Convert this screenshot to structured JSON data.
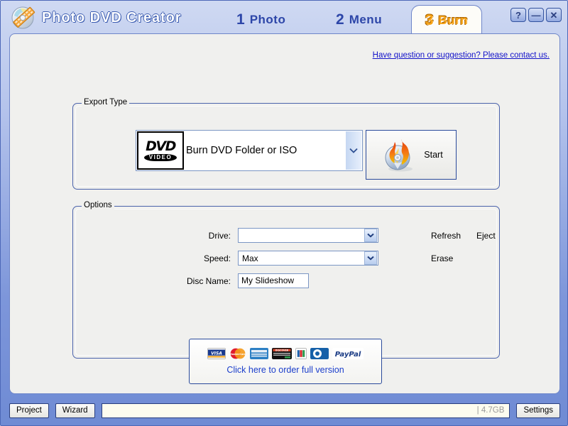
{
  "window": {
    "app_title": "Photo DVD Creator",
    "logo_icon": "disc-filmstrip-icon",
    "controls": [
      {
        "name": "help-button",
        "glyph": "?"
      },
      {
        "name": "minimize-button",
        "glyph": "—"
      },
      {
        "name": "close-button",
        "glyph": "✕"
      }
    ]
  },
  "tabs": [
    {
      "num": "1",
      "label": "Photo",
      "active": false
    },
    {
      "num": "2",
      "label": "Menu",
      "active": false
    },
    {
      "num": "3",
      "label": "Burn",
      "active": true
    }
  ],
  "contact_link": "Have question or suggestion? Please contact us.",
  "export_type": {
    "group_title": "Export Type",
    "combo_value": "Burn DVD Folder or ISO",
    "combo_icon": "dvd-video-logo",
    "dvd_logo_word": "DVD",
    "dvd_logo_sub": "VIDEO",
    "start_label": "Start",
    "start_icon": "burning-disc-icon"
  },
  "options": {
    "group_title": "Options",
    "drive": {
      "label": "Drive:",
      "value": ""
    },
    "speed": {
      "label": "Speed:",
      "value": "Max"
    },
    "disc_name": {
      "label": "Disc Name:",
      "value": "My Slideshow"
    },
    "actions": {
      "refresh": "Refresh",
      "eject": "Eject",
      "erase": "Erase"
    }
  },
  "order": {
    "link": "Click here to order full version",
    "cards": [
      {
        "name": "visa-icon",
        "label": "VISA"
      },
      {
        "name": "mastercard-icon",
        "label": "MasterCard"
      },
      {
        "name": "amex-icon",
        "label": "AMEX"
      },
      {
        "name": "discover-icon",
        "label": "DISCOVER"
      },
      {
        "name": "jcb-icon",
        "label": "JCB"
      },
      {
        "name": "diners-club-icon",
        "label": "Diners"
      },
      {
        "name": "paypal-icon",
        "label": "PayPal"
      }
    ]
  },
  "statusbar": {
    "project_label": "Project",
    "wizard_label": "Wizard",
    "progress_text": "| 4.7GB",
    "settings_label": "Settings"
  },
  "colors": {
    "title_blue": "#6f8bd4",
    "tab_active_text": "#f7a316",
    "tab_inactive_text": "#2d46a8",
    "link_blue": "#1414ca",
    "order_link_blue": "#1b3ecb",
    "panel_bg": "#f0f0ee",
    "group_border": "#4a62ab"
  }
}
